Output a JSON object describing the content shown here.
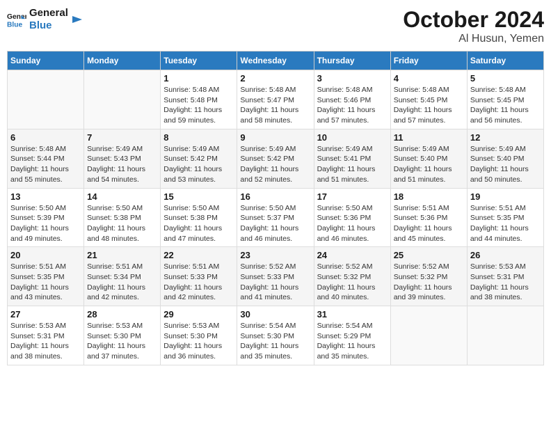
{
  "logo": {
    "line1": "General",
    "line2": "Blue"
  },
  "title": "October 2024",
  "subtitle": "Al Husun, Yemen",
  "days_of_week": [
    "Sunday",
    "Monday",
    "Tuesday",
    "Wednesday",
    "Thursday",
    "Friday",
    "Saturday"
  ],
  "weeks": [
    [
      {
        "day": "",
        "info": ""
      },
      {
        "day": "",
        "info": ""
      },
      {
        "day": "1",
        "info": "Sunrise: 5:48 AM\nSunset: 5:48 PM\nDaylight: 11 hours\nand 59 minutes."
      },
      {
        "day": "2",
        "info": "Sunrise: 5:48 AM\nSunset: 5:47 PM\nDaylight: 11 hours\nand 58 minutes."
      },
      {
        "day": "3",
        "info": "Sunrise: 5:48 AM\nSunset: 5:46 PM\nDaylight: 11 hours\nand 57 minutes."
      },
      {
        "day": "4",
        "info": "Sunrise: 5:48 AM\nSunset: 5:45 PM\nDaylight: 11 hours\nand 57 minutes."
      },
      {
        "day": "5",
        "info": "Sunrise: 5:48 AM\nSunset: 5:45 PM\nDaylight: 11 hours\nand 56 minutes."
      }
    ],
    [
      {
        "day": "6",
        "info": "Sunrise: 5:48 AM\nSunset: 5:44 PM\nDaylight: 11 hours\nand 55 minutes."
      },
      {
        "day": "7",
        "info": "Sunrise: 5:49 AM\nSunset: 5:43 PM\nDaylight: 11 hours\nand 54 minutes."
      },
      {
        "day": "8",
        "info": "Sunrise: 5:49 AM\nSunset: 5:42 PM\nDaylight: 11 hours\nand 53 minutes."
      },
      {
        "day": "9",
        "info": "Sunrise: 5:49 AM\nSunset: 5:42 PM\nDaylight: 11 hours\nand 52 minutes."
      },
      {
        "day": "10",
        "info": "Sunrise: 5:49 AM\nSunset: 5:41 PM\nDaylight: 11 hours\nand 51 minutes."
      },
      {
        "day": "11",
        "info": "Sunrise: 5:49 AM\nSunset: 5:40 PM\nDaylight: 11 hours\nand 51 minutes."
      },
      {
        "day": "12",
        "info": "Sunrise: 5:49 AM\nSunset: 5:40 PM\nDaylight: 11 hours\nand 50 minutes."
      }
    ],
    [
      {
        "day": "13",
        "info": "Sunrise: 5:50 AM\nSunset: 5:39 PM\nDaylight: 11 hours\nand 49 minutes."
      },
      {
        "day": "14",
        "info": "Sunrise: 5:50 AM\nSunset: 5:38 PM\nDaylight: 11 hours\nand 48 minutes."
      },
      {
        "day": "15",
        "info": "Sunrise: 5:50 AM\nSunset: 5:38 PM\nDaylight: 11 hours\nand 47 minutes."
      },
      {
        "day": "16",
        "info": "Sunrise: 5:50 AM\nSunset: 5:37 PM\nDaylight: 11 hours\nand 46 minutes."
      },
      {
        "day": "17",
        "info": "Sunrise: 5:50 AM\nSunset: 5:36 PM\nDaylight: 11 hours\nand 46 minutes."
      },
      {
        "day": "18",
        "info": "Sunrise: 5:51 AM\nSunset: 5:36 PM\nDaylight: 11 hours\nand 45 minutes."
      },
      {
        "day": "19",
        "info": "Sunrise: 5:51 AM\nSunset: 5:35 PM\nDaylight: 11 hours\nand 44 minutes."
      }
    ],
    [
      {
        "day": "20",
        "info": "Sunrise: 5:51 AM\nSunset: 5:35 PM\nDaylight: 11 hours\nand 43 minutes."
      },
      {
        "day": "21",
        "info": "Sunrise: 5:51 AM\nSunset: 5:34 PM\nDaylight: 11 hours\nand 42 minutes."
      },
      {
        "day": "22",
        "info": "Sunrise: 5:51 AM\nSunset: 5:33 PM\nDaylight: 11 hours\nand 42 minutes."
      },
      {
        "day": "23",
        "info": "Sunrise: 5:52 AM\nSunset: 5:33 PM\nDaylight: 11 hours\nand 41 minutes."
      },
      {
        "day": "24",
        "info": "Sunrise: 5:52 AM\nSunset: 5:32 PM\nDaylight: 11 hours\nand 40 minutes."
      },
      {
        "day": "25",
        "info": "Sunrise: 5:52 AM\nSunset: 5:32 PM\nDaylight: 11 hours\nand 39 minutes."
      },
      {
        "day": "26",
        "info": "Sunrise: 5:53 AM\nSunset: 5:31 PM\nDaylight: 11 hours\nand 38 minutes."
      }
    ],
    [
      {
        "day": "27",
        "info": "Sunrise: 5:53 AM\nSunset: 5:31 PM\nDaylight: 11 hours\nand 38 minutes."
      },
      {
        "day": "28",
        "info": "Sunrise: 5:53 AM\nSunset: 5:30 PM\nDaylight: 11 hours\nand 37 minutes."
      },
      {
        "day": "29",
        "info": "Sunrise: 5:53 AM\nSunset: 5:30 PM\nDaylight: 11 hours\nand 36 minutes."
      },
      {
        "day": "30",
        "info": "Sunrise: 5:54 AM\nSunset: 5:30 PM\nDaylight: 11 hours\nand 35 minutes."
      },
      {
        "day": "31",
        "info": "Sunrise: 5:54 AM\nSunset: 5:29 PM\nDaylight: 11 hours\nand 35 minutes."
      },
      {
        "day": "",
        "info": ""
      },
      {
        "day": "",
        "info": ""
      }
    ]
  ]
}
